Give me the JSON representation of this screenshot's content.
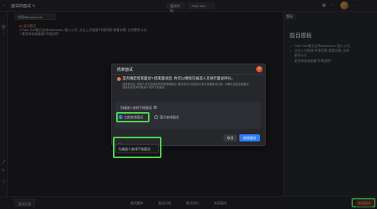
{
  "topbar": {
    "back_icon": "back-arrow-icon",
    "title": "面试的面试 ✎",
    "run_label": "面试代码",
    "language_label": "Plain Text",
    "icons": [
      "grid-icon",
      "bell-icon",
      "settings-icon",
      "user-avatar"
    ]
  },
  "editor": {
    "file_tab": "代码/filename.md",
    "lines": [
      {
        "num": "1",
        "text": "## 面试题目"
      },
      {
        "num": "2",
        "text": "// Plain Text格式支持Markdown, 插入公式, 点击上方链接\"环境切换\"查看详情. 支持更多公式"
      },
      {
        "num": "3",
        "text": "+ 更多帮助请查看\"环境说明\""
      }
    ]
  },
  "rightpane": {
    "tab_label": "题面",
    "title": "题目模板",
    "items": [
      "Plain Text格式支持Markdown, 插入公式,",
      "点击上方链接\"环境切换\"查看详情, 支持",
      "更多公式",
      "更多帮助请查看\"环境说明\""
    ]
  },
  "bottombar": {
    "left_label": "面试记录",
    "buttons": [
      "面试题库",
      "面试记录",
      "面试评价",
      "关闭面试"
    ],
    "end_label": "结束面试"
  },
  "dialog": {
    "title": "结束面试",
    "question": "是否确定结束面试? 结束面试后, 你可以继续在候选人页进行面试评价。",
    "detail": "结束面试后, 候选人将无法继续作答和查看题目, 面试官可以在面试记录中查看面试记录。请确认是否结束面试, 结束后可选择为候选人安排下轮面试。",
    "section_label": "为候选人安排下轮面试",
    "options": [
      {
        "label": "立即安排面试",
        "selected": true
      },
      {
        "label": "暂不安排面试",
        "selected": false
      }
    ],
    "cancel_label": "取消",
    "confirm_label": "结束面试",
    "tooltip": "为候选人安排下轮面试",
    "close_icon": "close-icon",
    "warn_icon": "warning-icon"
  }
}
